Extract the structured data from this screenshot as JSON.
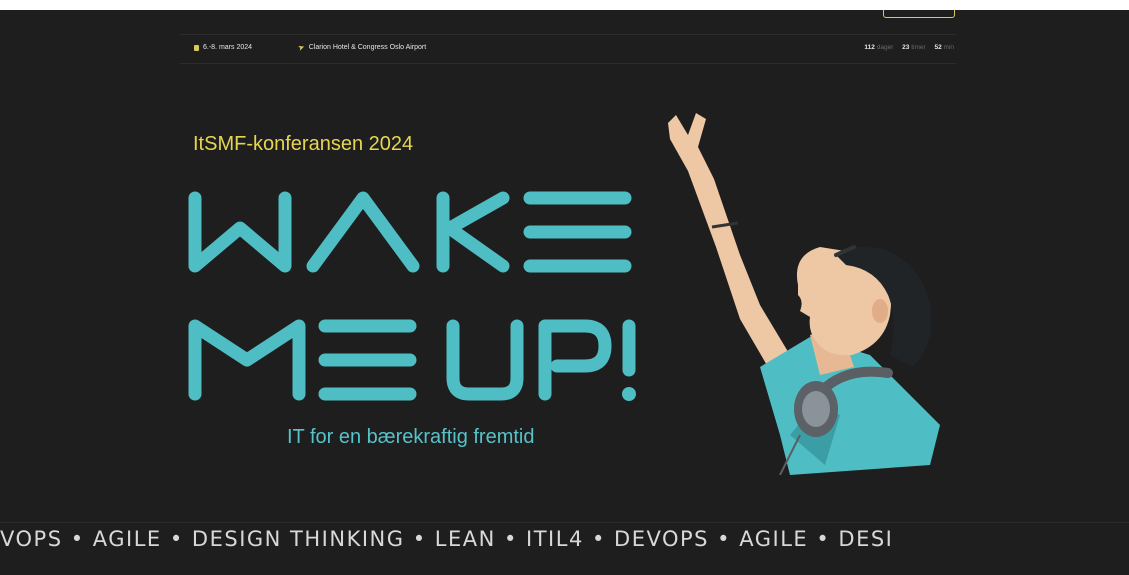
{
  "info_bar": {
    "date": "6.-8. mars 2024",
    "location": "Clarion Hotel & Congress Oslo Airport",
    "countdown": {
      "days_value": "112",
      "days_unit": "dager",
      "hours_value": "23",
      "hours_unit": "timer",
      "minutes_value": "52",
      "minutes_unit": "min"
    }
  },
  "hero": {
    "subtitle": "ItSMF-konferansen 2024",
    "title_line1": "WAKE",
    "title_line2": "ME UP!",
    "tagline": "IT for en bærekraftig fremtid"
  },
  "ticker": {
    "text": "VOPS  •  AGILE  •  DESIGN  THINKING  •  LEAN  •  ITIL4  •  DEVOPS  •  AGILE  •  DESI"
  },
  "colors": {
    "background": "#1e1e1f",
    "accent_yellow": "#e6d64f",
    "accent_teal": "#4fbec4",
    "ticker_text": "#d8d8d8"
  },
  "icons": [
    "calendar-icon",
    "location-pin-icon"
  ]
}
